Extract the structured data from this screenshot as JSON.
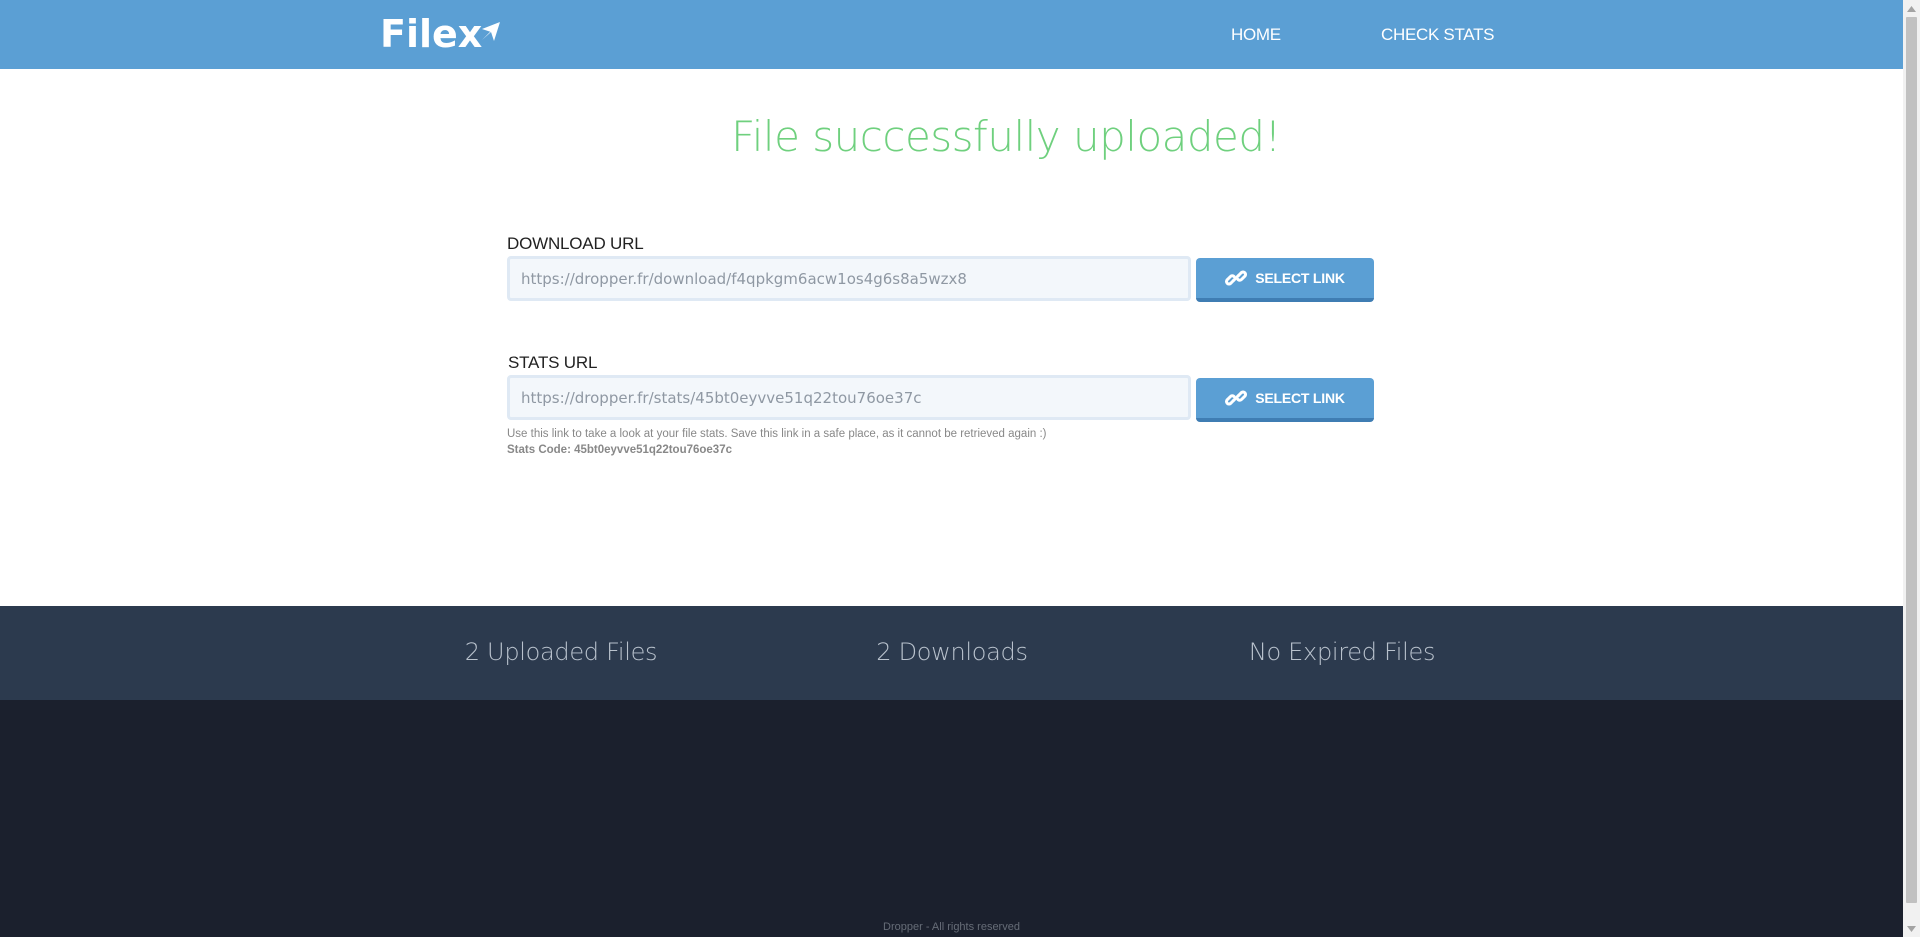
{
  "header": {
    "logo_text": "Filex",
    "nav": {
      "home": "HOME",
      "check_stats": "CHECK STATS"
    }
  },
  "main": {
    "headline": "File successfully uploaded!",
    "download": {
      "label": "DOWNLOAD URL",
      "value": "https://dropper.fr/download/f4qpkgm6acw1os4g6s8a5wzx8",
      "button_label": "SELECT LINK"
    },
    "stats": {
      "label": "STATS URL",
      "value": "https://dropper.fr/stats/45bt0eyvve51q22tou76oe37c",
      "button_label": "SELECT LINK",
      "hint": "Use this link to take a look at your file stats. Save this link in a safe place, as it cannot be retrieved again :)",
      "code_line": "Stats Code: 45bt0eyvve51q22tou76oe37c"
    }
  },
  "stats_band": {
    "uploaded": "2 Uploaded Files",
    "downloads": "2 Downloads",
    "expired": "No Expired Files"
  },
  "footer": {
    "copyright": "Dropper - All rights reserved"
  },
  "icons": {
    "logo": "paper-plane-icon",
    "button": "link-chain-icon"
  },
  "colors": {
    "header": "#5b9fd4",
    "success": "#6fd07e",
    "stats_band": "#2c3a4e",
    "footer": "#1b202d"
  }
}
